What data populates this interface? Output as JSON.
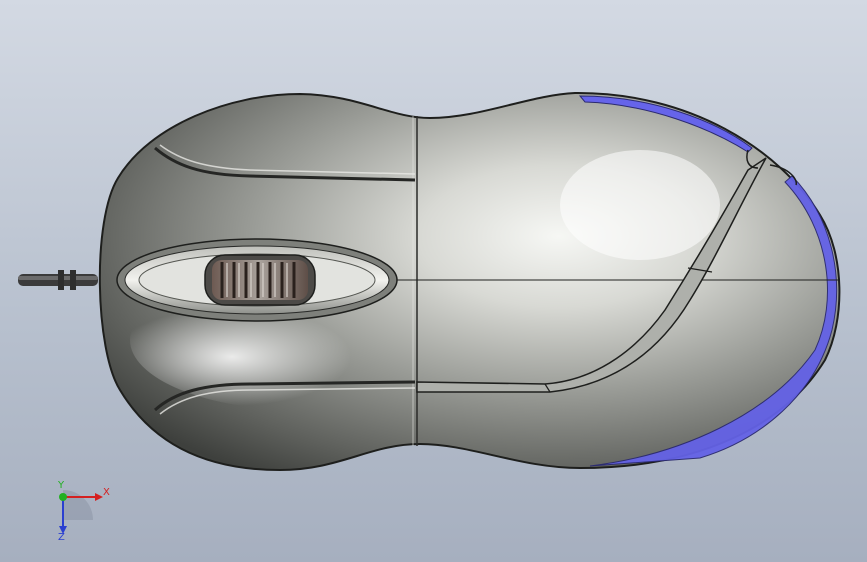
{
  "triad": {
    "x_label": "X",
    "y_label": "Y",
    "z_label": "Z",
    "colors": {
      "x": "#d42020",
      "y": "#22b022",
      "z": "#2a3fd0"
    }
  },
  "model": {
    "body_color": "#8a8c88",
    "highlight_color": "#f4f5f2",
    "accent_color": "#5a57e6",
    "cable_color": "#3b3b3b"
  }
}
